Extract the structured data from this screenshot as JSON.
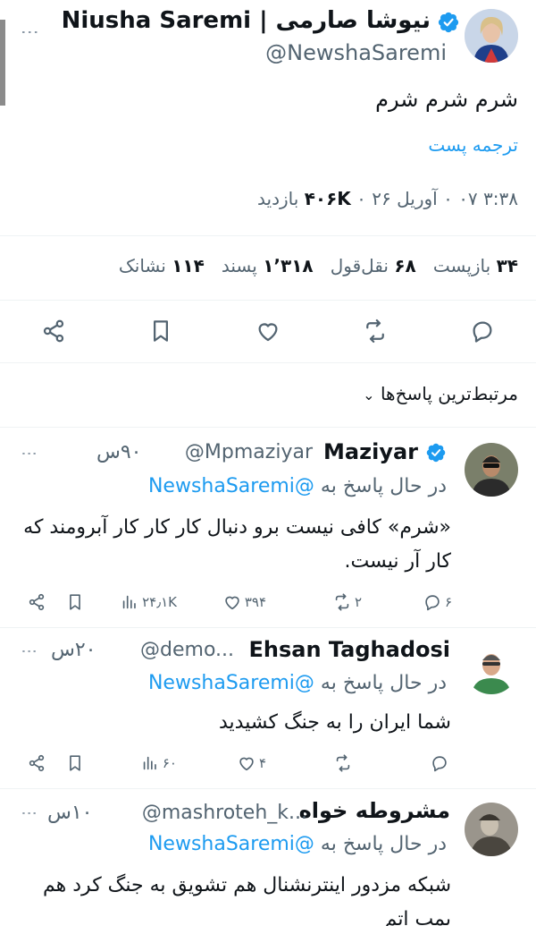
{
  "main_post": {
    "author_name": "Niusha Saremi | نیوشا صارمی",
    "handle": "@NewshaSaremi",
    "text": "شرم شرم شرم",
    "translate_label": "ترجمه پست",
    "timestamp": "۳:۳۸ ۰۷ ۰ آوریل ۲۶ ۰",
    "views_count": "۴۰۶K",
    "views_label": "بازدید",
    "stats": {
      "reposts_count": "۳۴",
      "reposts_label": "بازپست",
      "quotes_count": "۶۸",
      "quotes_label": "نقل‌قول",
      "likes_count": "۱٬۳۱۸",
      "likes_label": "پسند",
      "bookmarks_count": "۱۱۴",
      "bookmarks_label": "نشانک"
    },
    "actions": [
      "reply-icon",
      "repost-icon",
      "like-icon",
      "bookmark-icon",
      "share-icon"
    ]
  },
  "sort_label": "مرتبط‌ترین پاسخ‌ها",
  "replies": [
    {
      "name": "Maziyar",
      "handle": "@Mpmaziyar",
      "time": "۹۰س",
      "reply_to_prefix": "در حال پاسخ به",
      "reply_to": "@NewshaSaremi",
      "text": "«شرم» کافی نیست برو دنبال کار کار کار آبرومند که کار آر نیست.",
      "replies": "۶",
      "reposts": "۲",
      "likes": "۳۹۴",
      "views": "۲۴٫۱K"
    },
    {
      "name": "Ehsan Taghadosi",
      "handle": "@demo...",
      "time": "۲۰س",
      "reply_to_prefix": "در حال پاسخ به",
      "reply_to": "@NewshaSaremi",
      "text": "شما ایران را به جنگ کشیدید",
      "replies": "",
      "reposts": "",
      "likes": "۴",
      "views": "۶۰"
    },
    {
      "name": "مشروطه خواه",
      "handle": "@mashroteh_k...",
      "time": "۱۰س",
      "reply_to_prefix": "در حال پاسخ به",
      "reply_to": "@NewshaSaremi",
      "text": "شبکه مزدور اینترنشنال هم تشویق به جنگ کرد هم بمب اتم"
    }
  ],
  "colors": {
    "accent": "#1d9bf0",
    "muted": "#536471",
    "text": "#0f1419"
  }
}
